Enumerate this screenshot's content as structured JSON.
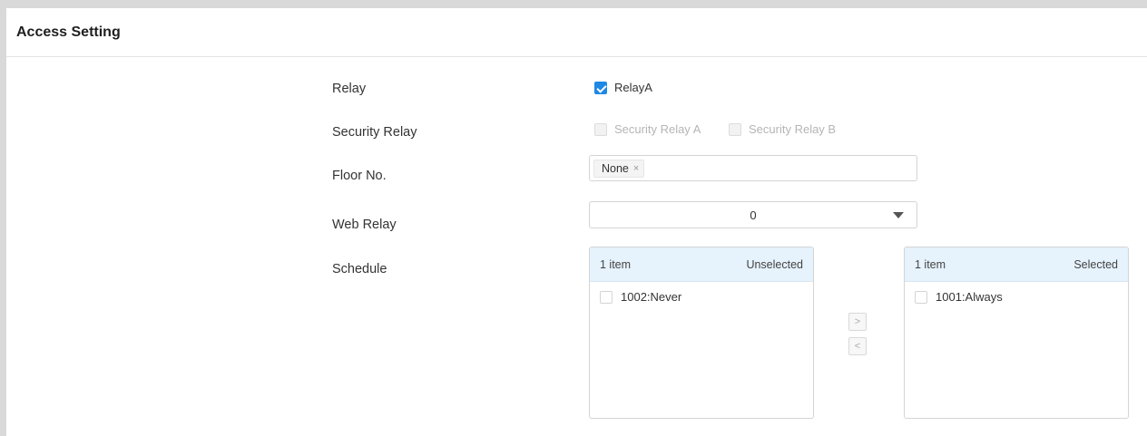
{
  "section": {
    "title": "Access Setting"
  },
  "relay": {
    "label": "Relay",
    "options": [
      {
        "label": "RelayA",
        "checked": true
      }
    ]
  },
  "security_relay": {
    "label": "Security Relay",
    "options": [
      {
        "label": "Security Relay A",
        "checked": false,
        "disabled": true
      },
      {
        "label": "Security Relay B",
        "checked": false,
        "disabled": true
      }
    ]
  },
  "floor": {
    "label": "Floor No.",
    "tags": [
      {
        "label": "None",
        "close": "×"
      }
    ]
  },
  "web_relay": {
    "label": "Web Relay",
    "value": "0"
  },
  "schedule": {
    "label": "Schedule",
    "unselected": {
      "count": "1 item",
      "title": "Unselected",
      "items": [
        {
          "label": "1002:Never",
          "checked": false
        }
      ]
    },
    "selected": {
      "count": "1 item",
      "title": "Selected",
      "items": [
        {
          "label": "1001:Always",
          "checked": false
        }
      ]
    },
    "move_right": ">",
    "move_left": "<"
  },
  "colors": {
    "accent": "#1e88e5",
    "header_bg": "#e6f2fc"
  }
}
